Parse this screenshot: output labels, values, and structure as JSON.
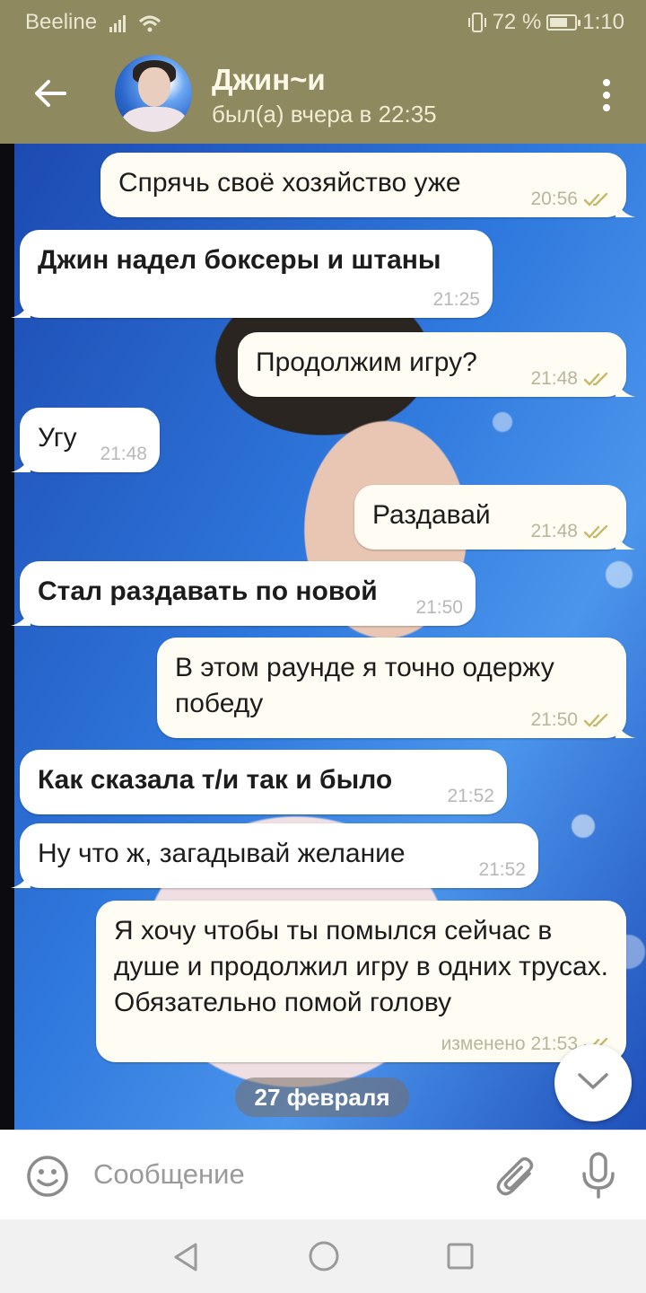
{
  "status_bar": {
    "carrier": "Beeline",
    "battery": "72 %",
    "battery_level": 0.72,
    "time": "1:10"
  },
  "header": {
    "contact_name": "Джин~и",
    "last_seen": "был(а) вчера в 22:35",
    "icons": [
      "back-arrow-icon",
      "avatar",
      "more-vert-icon"
    ]
  },
  "messages": [
    {
      "direction": "out",
      "text": "Спрячь своё хозяйство уже",
      "time": "20:56",
      "read": true
    },
    {
      "direction": "in",
      "text": "Джин надел боксеры и штаны",
      "time": "21:25",
      "bold": true
    },
    {
      "direction": "out",
      "text": "Продолжим игру?",
      "time": "21:48",
      "read": true
    },
    {
      "direction": "in",
      "text": "Угу",
      "time": "21:48"
    },
    {
      "direction": "out",
      "text": "Раздавай",
      "time": "21:48",
      "read": true
    },
    {
      "direction": "in",
      "text": "Стал раздавать по новой",
      "time": "21:50",
      "bold": true
    },
    {
      "direction": "out",
      "text": "В этом раунде я точно одержу победу",
      "time": "21:50",
      "read": true
    },
    {
      "direction": "in",
      "text": "Как сказала т/и так и было",
      "time": "21:52",
      "bold": true
    },
    {
      "direction": "in",
      "text": "Ну что ж, загадывай желание",
      "time": "21:52"
    },
    {
      "direction": "out",
      "text": "Я хочу чтобы ты помылся сейчас в душе и продолжил игру в одних трусах. Обязательно помой голову",
      "time": "изменено 21:53",
      "read": true
    }
  ],
  "date_separator": "27 февраля",
  "input": {
    "placeholder": "Сообщение",
    "value": ""
  },
  "colors": {
    "header": "#8f895f",
    "bubble_out": "#fffdf3",
    "bubble_in": "#ffffff",
    "read_check": "#c8b86a"
  }
}
